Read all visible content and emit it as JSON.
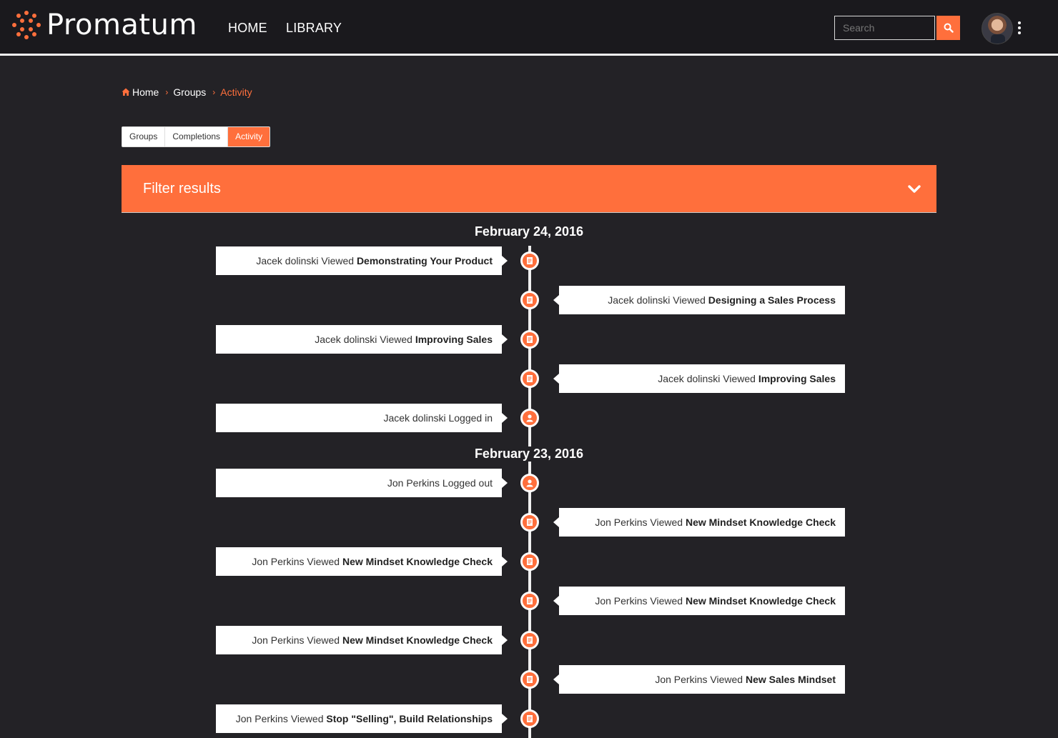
{
  "brand": {
    "name": "Promatum",
    "accent": "#ff6f3c"
  },
  "nav": {
    "home": "HOME",
    "library": "LIBRARY"
  },
  "search": {
    "placeholder": "Search"
  },
  "breadcrumb": {
    "home": "Home",
    "groups": "Groups",
    "activity": "Activity"
  },
  "tabs": [
    "Groups",
    "Completions",
    "Activity"
  ],
  "active_tab": "Activity",
  "filter": {
    "title": "Filter results"
  },
  "timeline": {
    "dates": [
      "February 24, 2016",
      "February 23, 2016"
    ],
    "entries": [
      {
        "user": "Jacek dolinski",
        "action": "Viewed",
        "target": "Demonstrating Your Product",
        "icon": "document-icon"
      },
      {
        "user": "Jacek dolinski",
        "action": "Viewed",
        "target": "Designing a Sales Process",
        "icon": "document-icon"
      },
      {
        "user": "Jacek dolinski",
        "action": "Viewed",
        "target": "Improving Sales",
        "icon": "document-icon"
      },
      {
        "user": "Jacek dolinski",
        "action": "Viewed",
        "target": "Improving Sales",
        "icon": "document-icon"
      },
      {
        "user": "Jacek dolinski",
        "action": "Logged in",
        "target": "",
        "icon": "user-icon"
      },
      {
        "user": "Jon Perkins",
        "action": "Logged out",
        "target": "",
        "icon": "user-icon"
      },
      {
        "user": "Jon Perkins",
        "action": "Viewed",
        "target": "New Mindset Knowledge Check",
        "icon": "document-icon"
      },
      {
        "user": "Jon Perkins",
        "action": "Viewed",
        "target": "New Mindset Knowledge Check",
        "icon": "document-icon"
      },
      {
        "user": "Jon Perkins",
        "action": "Viewed",
        "target": "New Mindset Knowledge Check",
        "icon": "document-icon"
      },
      {
        "user": "Jon Perkins",
        "action": "Viewed",
        "target": "New Mindset Knowledge Check",
        "icon": "document-icon"
      },
      {
        "user": "Jon Perkins",
        "action": "Viewed",
        "target": "New Sales Mindset",
        "icon": "document-icon"
      },
      {
        "user": "Jon Perkins",
        "action": "Viewed",
        "target": "Stop \"Selling\", Build Relationships",
        "icon": "document-icon"
      }
    ]
  }
}
